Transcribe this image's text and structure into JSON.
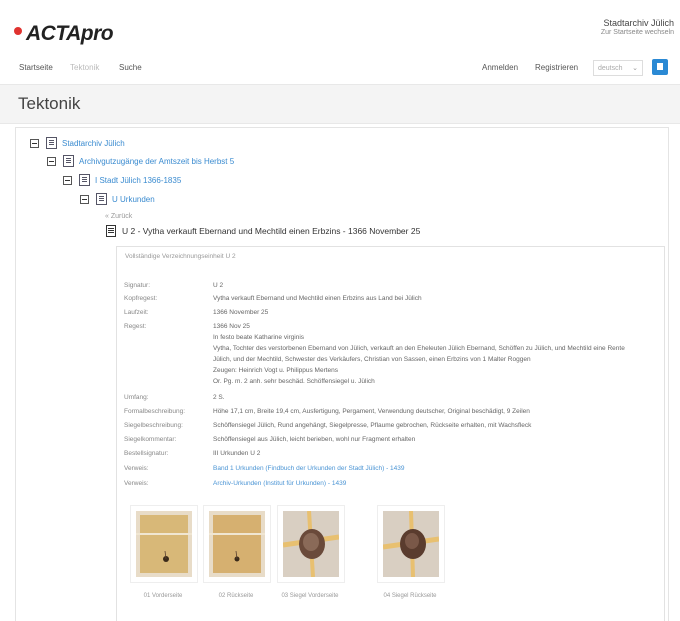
{
  "header": {
    "logo_text": "ACTApro",
    "archive_name": "Stadtarchiv Jülich",
    "archive_sub": "Zur Startseite wechseln"
  },
  "nav": {
    "items": [
      {
        "label": "Startseite",
        "active": true
      },
      {
        "label": "Tektonik",
        "active": false
      },
      {
        "label": "Suche",
        "active": true
      }
    ],
    "login": "Anmelden",
    "register": "Registrieren",
    "language": "deutsch"
  },
  "page": {
    "title": "Tektonik"
  },
  "tree": [
    {
      "label": "Stadtarchiv Jülich"
    },
    {
      "label": "Archivgutzugänge der Amtszeit bis Herbst 5"
    },
    {
      "label": "I Stadt Jülich 1366-1835"
    },
    {
      "label": "U Urkunden"
    }
  ],
  "back_label": "« Zurück",
  "current_record": "U 2 - Vytha verkauft Ebernand und Mechtild einen Erbzins - 1366 November 25",
  "detail": {
    "permalink_label": "Vollständige Verzeichnungseinheit U 2",
    "fields": [
      {
        "label": "Signatur:",
        "value": "U 2"
      },
      {
        "label": "Kopfregest:",
        "value": "Vytha verkauft Ebernand und Mechtild einen Erbzins aus Land bei Jülich"
      },
      {
        "label": "Laufzeit:",
        "value": "1366 November 25"
      },
      {
        "label": "Regest:",
        "value": "1366 Nov 25"
      },
      {
        "label": "",
        "value": "In festo beate Katharine virginis"
      },
      {
        "label": "",
        "value": "Vytha, Tochter des verstorbenen Ebernand von Jülich, verkauft an den Eheleuten Jülich Ebernand, Schöffen zu Jülich, und Mechtild eine Rente"
      },
      {
        "label": "",
        "value": "Jülich, und der Mechtild, Schwester des Verkäufers, Christian von Sassen, einen Erbzins von 1 Malter Roggen"
      },
      {
        "label": "",
        "value": "Zeugen: Heinrich Vogt u. Philippus Mertens"
      },
      {
        "label": "",
        "value": "Or. Pg. m. 2 anh. sehr beschäd. Schöffensiegel u. Jülich"
      },
      {
        "label": "Umfang:",
        "value": "2 S."
      },
      {
        "label": "Formalbeschreibung:",
        "value": "Höhe 17,1 cm, Breite 19,4 cm, Ausfertigung, Pergament, Verwendung deutscher, Original beschädigt, 9 Zeilen"
      },
      {
        "label": "Siegelbeschreibung:",
        "value": "Schöffensiegel Jülich, Rund angehängt, Siegelpresse, Pflaume gebrochen, Rückseite erhalten, mit Wachsfleck"
      },
      {
        "label": "Siegelkommentar:",
        "value": "Schöffensiegel aus Jülich, leicht berieben, wohl nur Fragment erhalten"
      },
      {
        "label": "Bestellsignatur:",
        "value": "III Urkunden U 2"
      },
      {
        "label": "Verweis:",
        "value": "Band 1 Urkunden (Findbuch der Urkunden der Stadt Jülich) - 1439",
        "link": true
      },
      {
        "label": "Verweis:",
        "value": "Archiv-Urkunden (Institut für Urkunden) - 1439",
        "link": true
      }
    ]
  },
  "images": [
    {
      "caption": "01 Vorderseite",
      "type": "doc"
    },
    {
      "caption": "02 Rückseite",
      "type": "doc"
    },
    {
      "caption": "03 Siegel Vorderseite",
      "type": "seal"
    },
    {
      "caption": "04 Siegel Rückseite",
      "type": "seal"
    }
  ],
  "colors": {
    "accent": "#2a89d4",
    "link": "#3a8bd0",
    "logo_dot": "#e0322f"
  }
}
